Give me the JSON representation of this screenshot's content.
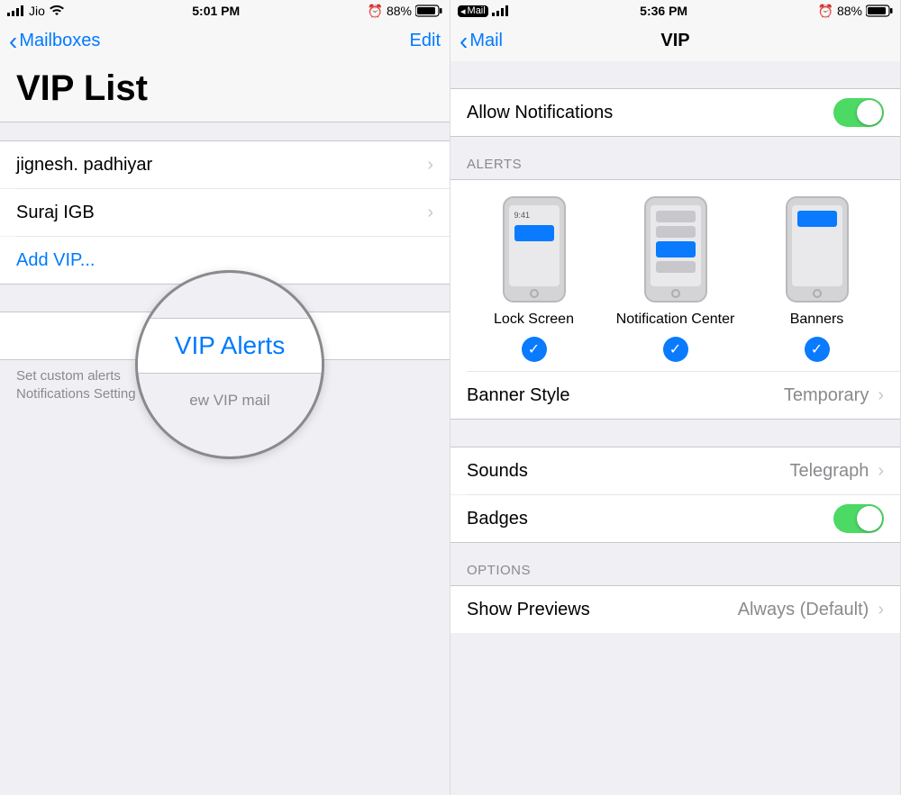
{
  "left": {
    "status": {
      "carrier": "Jio",
      "time": "5:01 PM",
      "battery": "88%"
    },
    "nav": {
      "back": "Mailboxes",
      "edit": "Edit"
    },
    "title": "VIP List",
    "vips": [
      "jignesh. padhiyar",
      "Suraj IGB"
    ],
    "add_vip": "Add VIP...",
    "vip_alerts": "VIP Alerts",
    "footer_l1": "Set custom alerts",
    "footer_l2": "Notifications Setting",
    "mag_alerts": "VIP Alerts",
    "mag_foot": "ew VIP mail"
  },
  "right": {
    "status": {
      "breadcrumb": "Mail",
      "time": "5:36 PM",
      "battery": "88%"
    },
    "nav": {
      "back": "Mail",
      "title": "VIP"
    },
    "allow": {
      "label": "Allow Notifications"
    },
    "section_alerts": "ALERTS",
    "alert_opts": {
      "lock": "Lock Screen",
      "nc": "Notification Center",
      "banners": "Banners",
      "lock_time": "9:41"
    },
    "banner_style": {
      "label": "Banner Style",
      "value": "Temporary"
    },
    "sounds": {
      "label": "Sounds",
      "value": "Telegraph"
    },
    "badges": {
      "label": "Badges"
    },
    "section_options": "OPTIONS",
    "previews": {
      "label": "Show Previews",
      "value": "Always (Default)"
    }
  }
}
